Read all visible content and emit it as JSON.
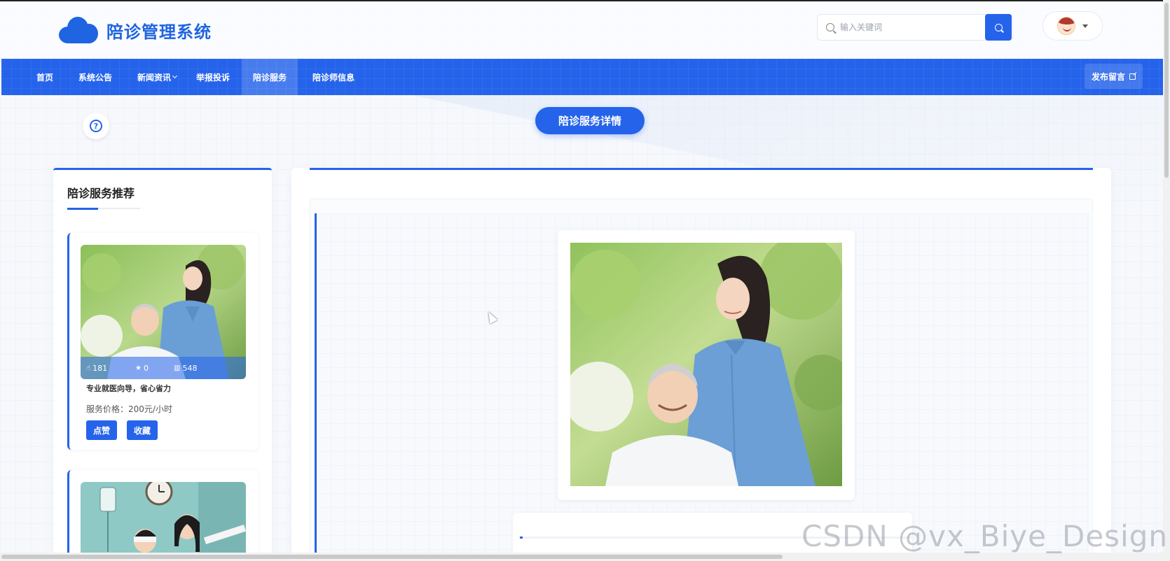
{
  "header": {
    "title": "陪诊管理系统",
    "search_placeholder": "输入关键词"
  },
  "nav": {
    "items": [
      {
        "label": "首页"
      },
      {
        "label": "系统公告"
      },
      {
        "label": "新闻资讯"
      },
      {
        "label": "举报投诉"
      },
      {
        "label": "陪诊服务"
      },
      {
        "label": "陪诊师信息"
      }
    ],
    "publish_label": "发布留言"
  },
  "page": {
    "title": "陪诊服务详情",
    "help_glyph": "?"
  },
  "sidebar": {
    "title": "陪诊服务推荐",
    "cards": [
      {
        "likes": "181",
        "stars": "0",
        "views": "548",
        "description": "专业就医向导，省心省力",
        "price": "服务价格：200元/小时",
        "like_label": "点赞",
        "favorite_label": "收藏"
      }
    ]
  },
  "watermark": "CSDN @vx_Biye_Design",
  "colors": {
    "primary": "#2563eb",
    "background": "#f6f8fc"
  }
}
